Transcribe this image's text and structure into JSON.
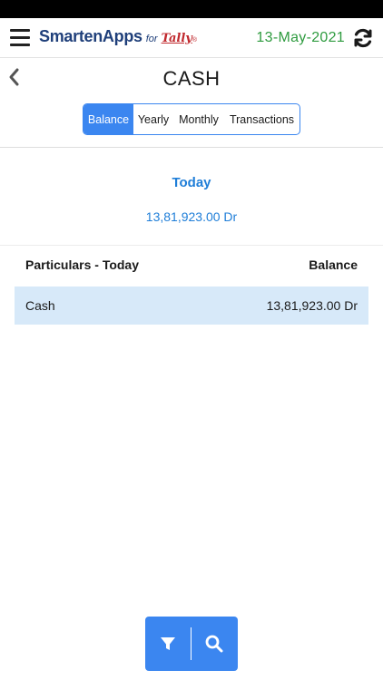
{
  "header": {
    "brand_name": "SmartenApps",
    "brand_for": "for",
    "brand_tally": "Tally",
    "brand_reg": "®",
    "date": "13-May-2021"
  },
  "page": {
    "title": "CASH"
  },
  "tabs": [
    {
      "label": "Balance",
      "active": true
    },
    {
      "label": "Yearly",
      "active": false
    },
    {
      "label": "Monthly",
      "active": false
    },
    {
      "label": "Transactions",
      "active": false
    }
  ],
  "summary": {
    "label": "Today",
    "value": "13,81,923.00 Dr"
  },
  "table": {
    "columns": [
      "Particulars - Today",
      "Balance"
    ],
    "rows": [
      {
        "particular": "Cash",
        "balance": "13,81,923.00 Dr"
      }
    ]
  },
  "colors": {
    "accent": "#3b86f0",
    "date_green": "#2e9b3f",
    "summary_blue": "#1f7ed8",
    "row_highlight": "#d7e9f9",
    "brand_navy": "#1f3f7a",
    "brand_red": "#c0282d"
  },
  "icons": {
    "menu": "hamburger-menu-icon",
    "refresh": "refresh-icon",
    "back": "chevron-left-icon",
    "filter": "filter-icon",
    "search": "search-icon"
  }
}
